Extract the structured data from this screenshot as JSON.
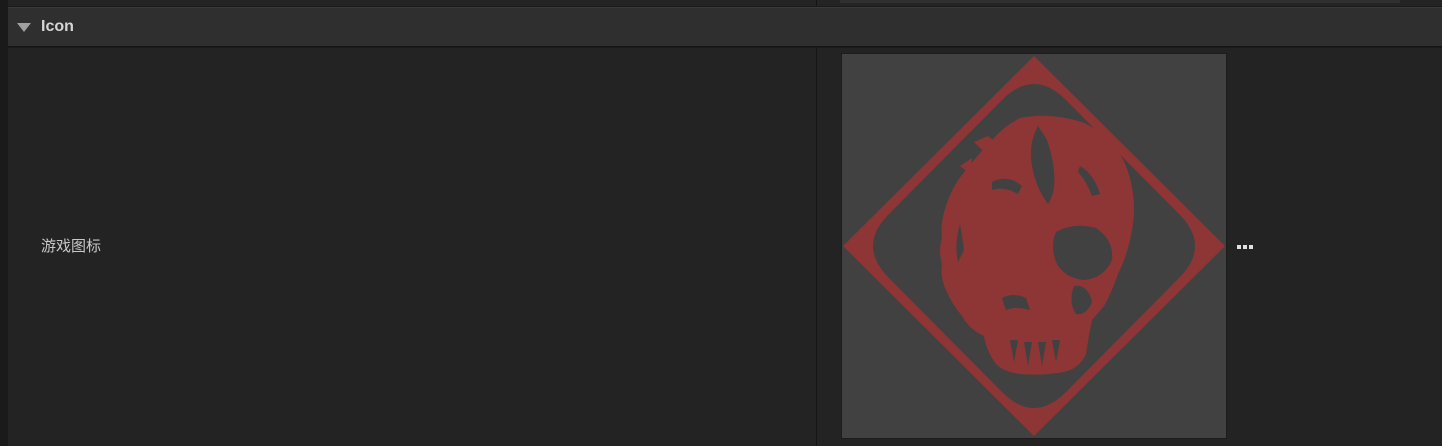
{
  "section": {
    "title": "Icon",
    "expanded": true
  },
  "property": {
    "label": "游戏图标",
    "value_kind": "texture-thumbnail",
    "icon_semantic": "skull-diamond-icon",
    "more_button": "ellipsis-icon"
  },
  "colors": {
    "panel_bg": "#232323",
    "header_bg": "#2f2f2f",
    "thumb_bg": "#414141",
    "icon_red": "#8e3535"
  }
}
